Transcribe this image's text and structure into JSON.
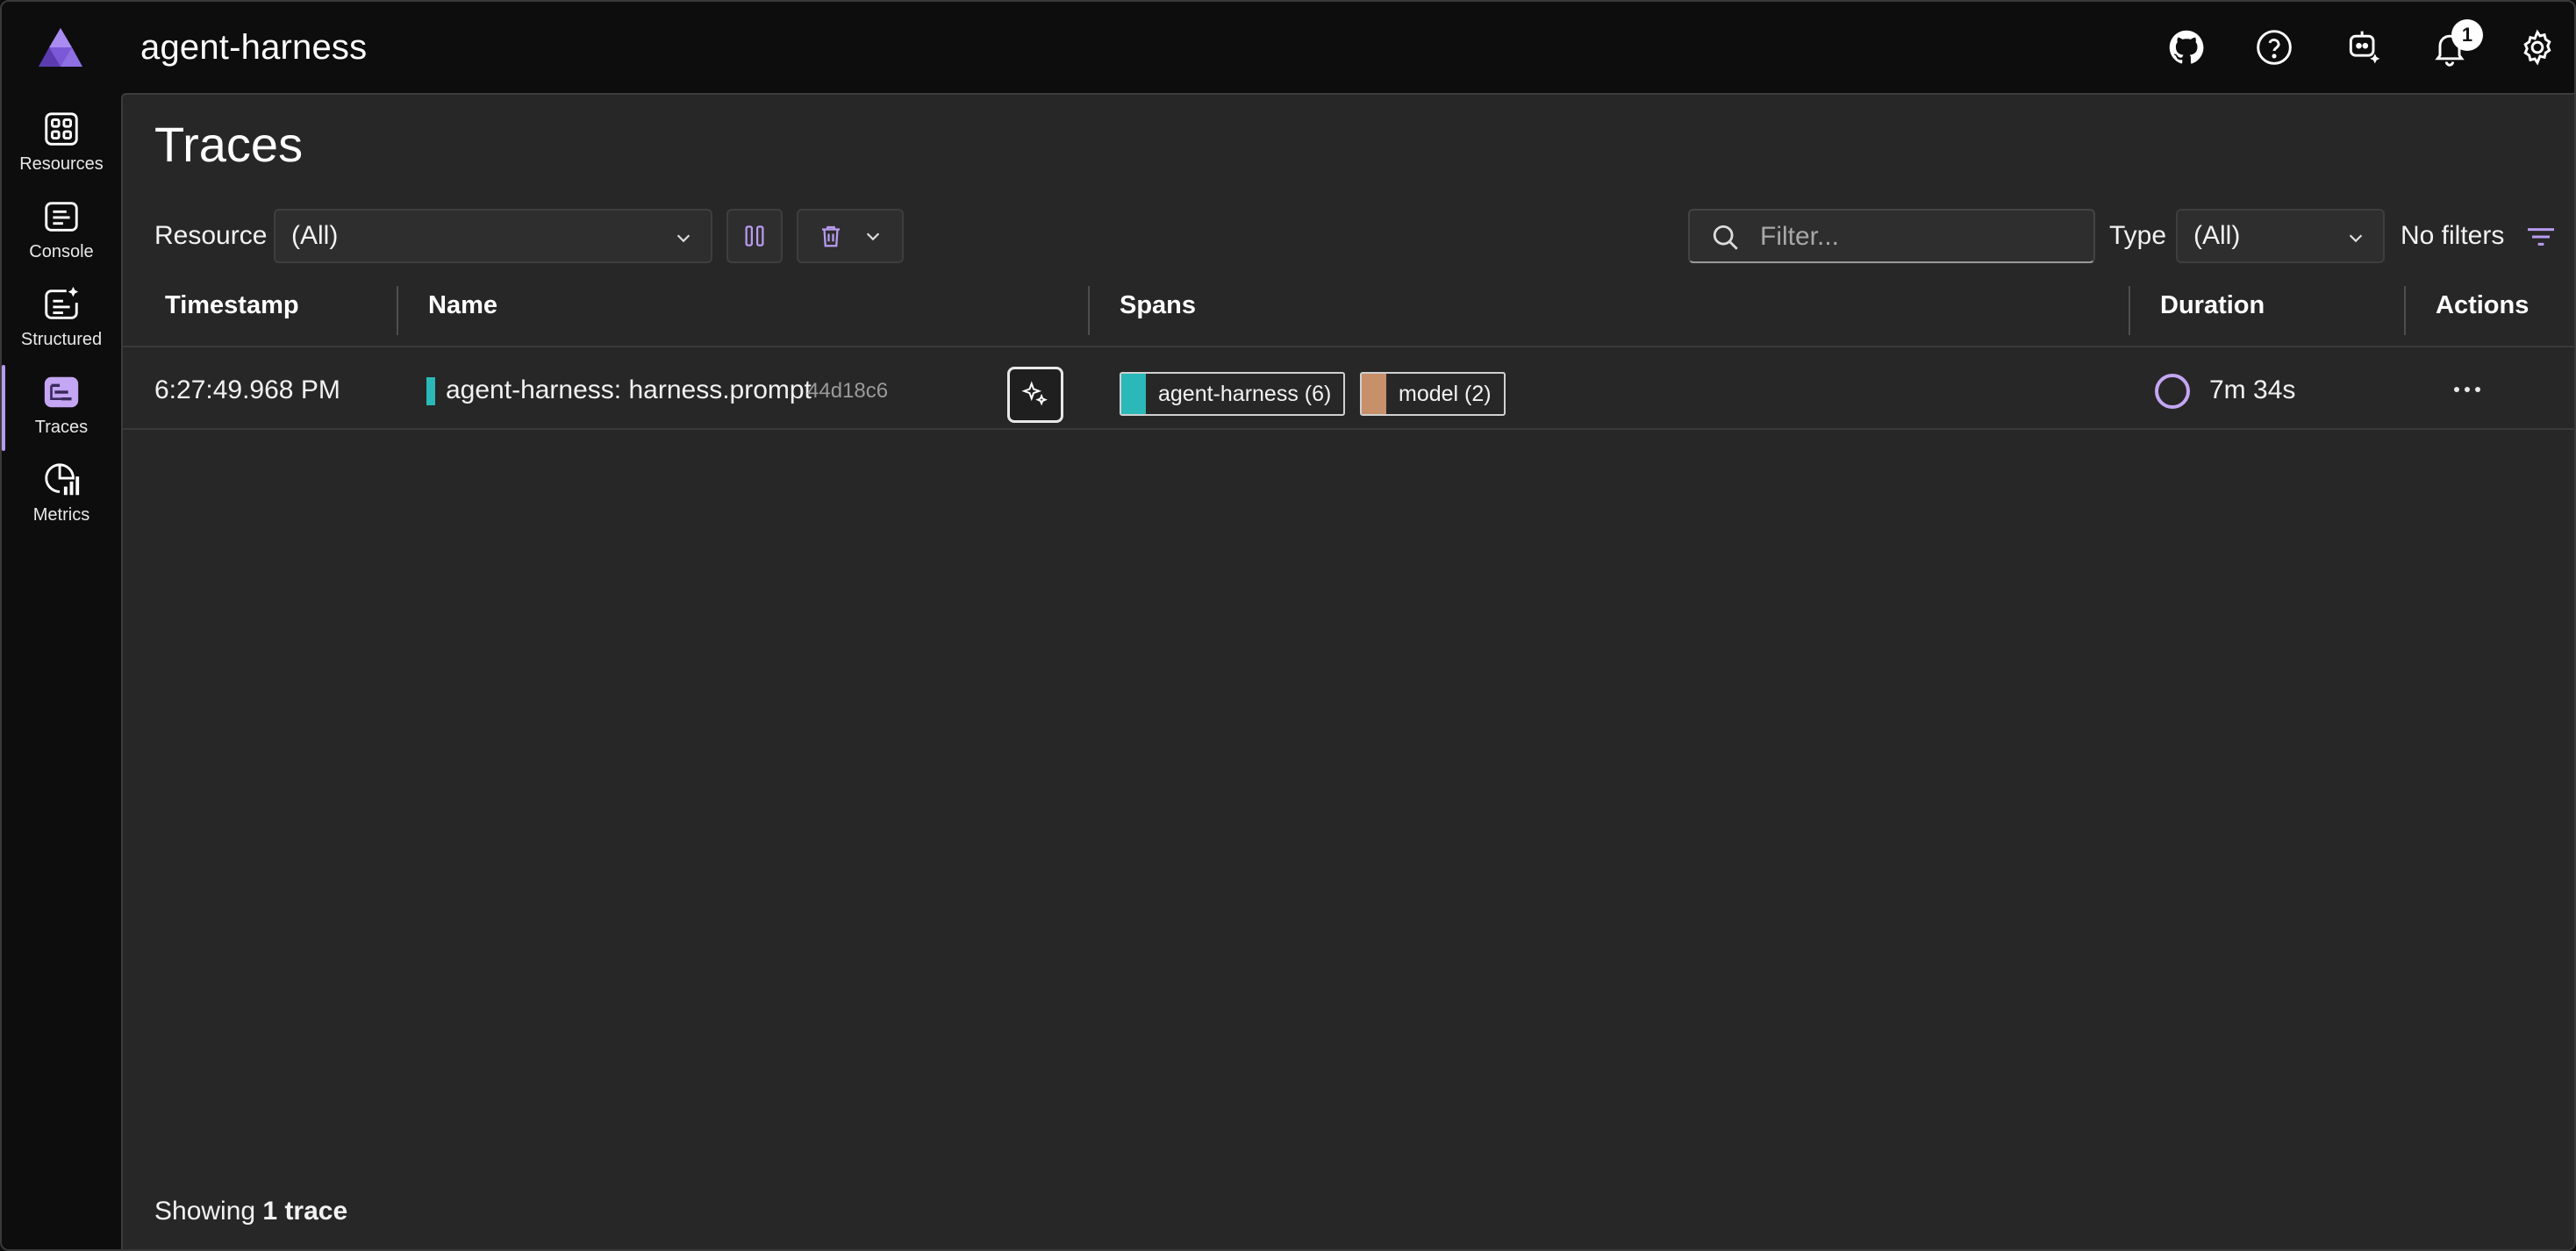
{
  "app": {
    "title": "agent-harness",
    "notification_count": "1",
    "accent_color": "#b79af0"
  },
  "topbar_icons": [
    "github-icon",
    "help-icon",
    "copilot-icon",
    "notification-bell-icon",
    "settings-gear-icon"
  ],
  "sidebar": {
    "items": [
      {
        "label": "Resources",
        "icon": "resources-grid-icon",
        "active": false
      },
      {
        "label": "Console",
        "icon": "console-icon",
        "active": false
      },
      {
        "label": "Structured",
        "icon": "structured-logs-icon",
        "active": false
      },
      {
        "label": "Traces",
        "icon": "traces-icon",
        "active": true
      },
      {
        "label": "Metrics",
        "icon": "metrics-icon",
        "active": false
      }
    ]
  },
  "page": {
    "title": "Traces"
  },
  "toolbar": {
    "resource_label": "Resource",
    "resource_value": "(All)",
    "search_placeholder": "Filter...",
    "type_label": "Type",
    "type_value": "(All)",
    "filters_label": "No filters"
  },
  "grid": {
    "columns": [
      "Timestamp",
      "Name",
      "Spans",
      "Duration",
      "Actions"
    ],
    "rows": [
      {
        "timestamp": "6:27:49.968 PM",
        "name": "agent-harness: harness.prompt",
        "trace_id": "44d18c6",
        "spans": [
          {
            "label": "agent-harness (6)",
            "color": "#2bb8b8"
          },
          {
            "label": "model (2)",
            "color": "#c8906a"
          }
        ],
        "duration": "7m 34s"
      }
    ]
  },
  "footer": {
    "prefix": "Showing",
    "count": "1 trace"
  }
}
